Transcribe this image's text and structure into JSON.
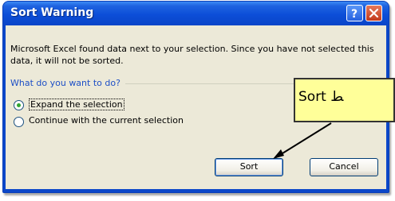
{
  "dialog": {
    "title": "Sort Warning",
    "message": "Microsoft Excel found data next to your selection.  Since you have not selected this data, it will not be sorted.",
    "question": "What do you want to do?",
    "options": [
      {
        "label": "Expand the selection",
        "mnemonic": "E",
        "selected": true
      },
      {
        "label": "Continue with the current selection",
        "mnemonic": "C",
        "selected": false
      }
    ],
    "sort_button": "Sort",
    "cancel_button": "Cancel"
  },
  "callout": {
    "text": "Sort ﻂ"
  },
  "colors": {
    "titlebar": "#0c4ed8",
    "client": "#ece9d8",
    "caption": "#1d4fc6",
    "callout_bg": "#ffff99"
  },
  "icons": {
    "help": "question-mark-icon",
    "close": "close-x-icon"
  }
}
